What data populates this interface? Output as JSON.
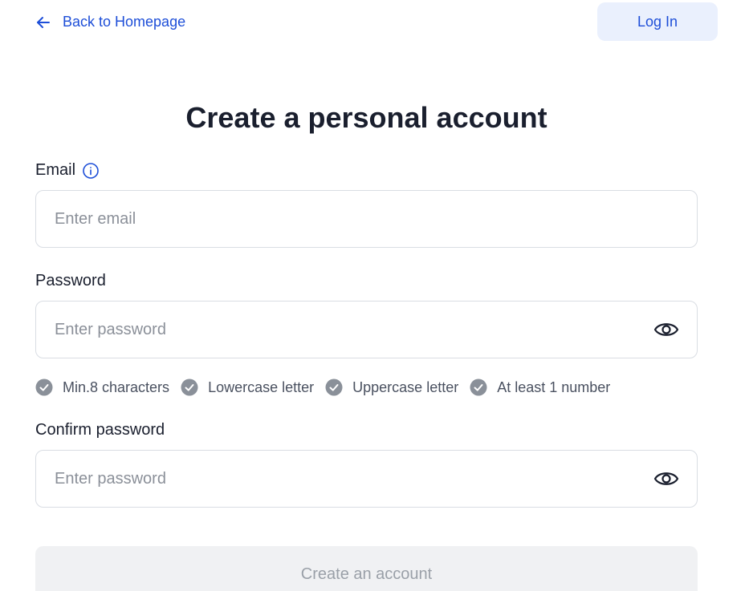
{
  "header": {
    "back_label": "Back to Homepage",
    "login_label": "Log In"
  },
  "title": "Create a personal account",
  "email": {
    "label": "Email",
    "placeholder": "Enter email",
    "value": ""
  },
  "password": {
    "label": "Password",
    "placeholder": "Enter password",
    "value": ""
  },
  "rules": [
    {
      "label": "Min.8 characters",
      "met": false
    },
    {
      "label": "Lowercase letter",
      "met": false
    },
    {
      "label": "Uppercase letter",
      "met": false
    },
    {
      "label": "At least 1 number",
      "met": false
    }
  ],
  "confirm_password": {
    "label": "Confirm password",
    "placeholder": "Enter password",
    "value": ""
  },
  "submit": {
    "label": "Create an account",
    "enabled": false
  },
  "icons": {
    "back": "arrow-left-icon",
    "info": "info-icon",
    "eye": "eye-icon",
    "check": "check-circle-icon"
  },
  "colors": {
    "accent": "#1d4ed8",
    "login_bg": "#eaf0fd",
    "check": "#8a9099",
    "disabled_bg": "#f0f1f3",
    "disabled_text": "#9aa0a8"
  }
}
